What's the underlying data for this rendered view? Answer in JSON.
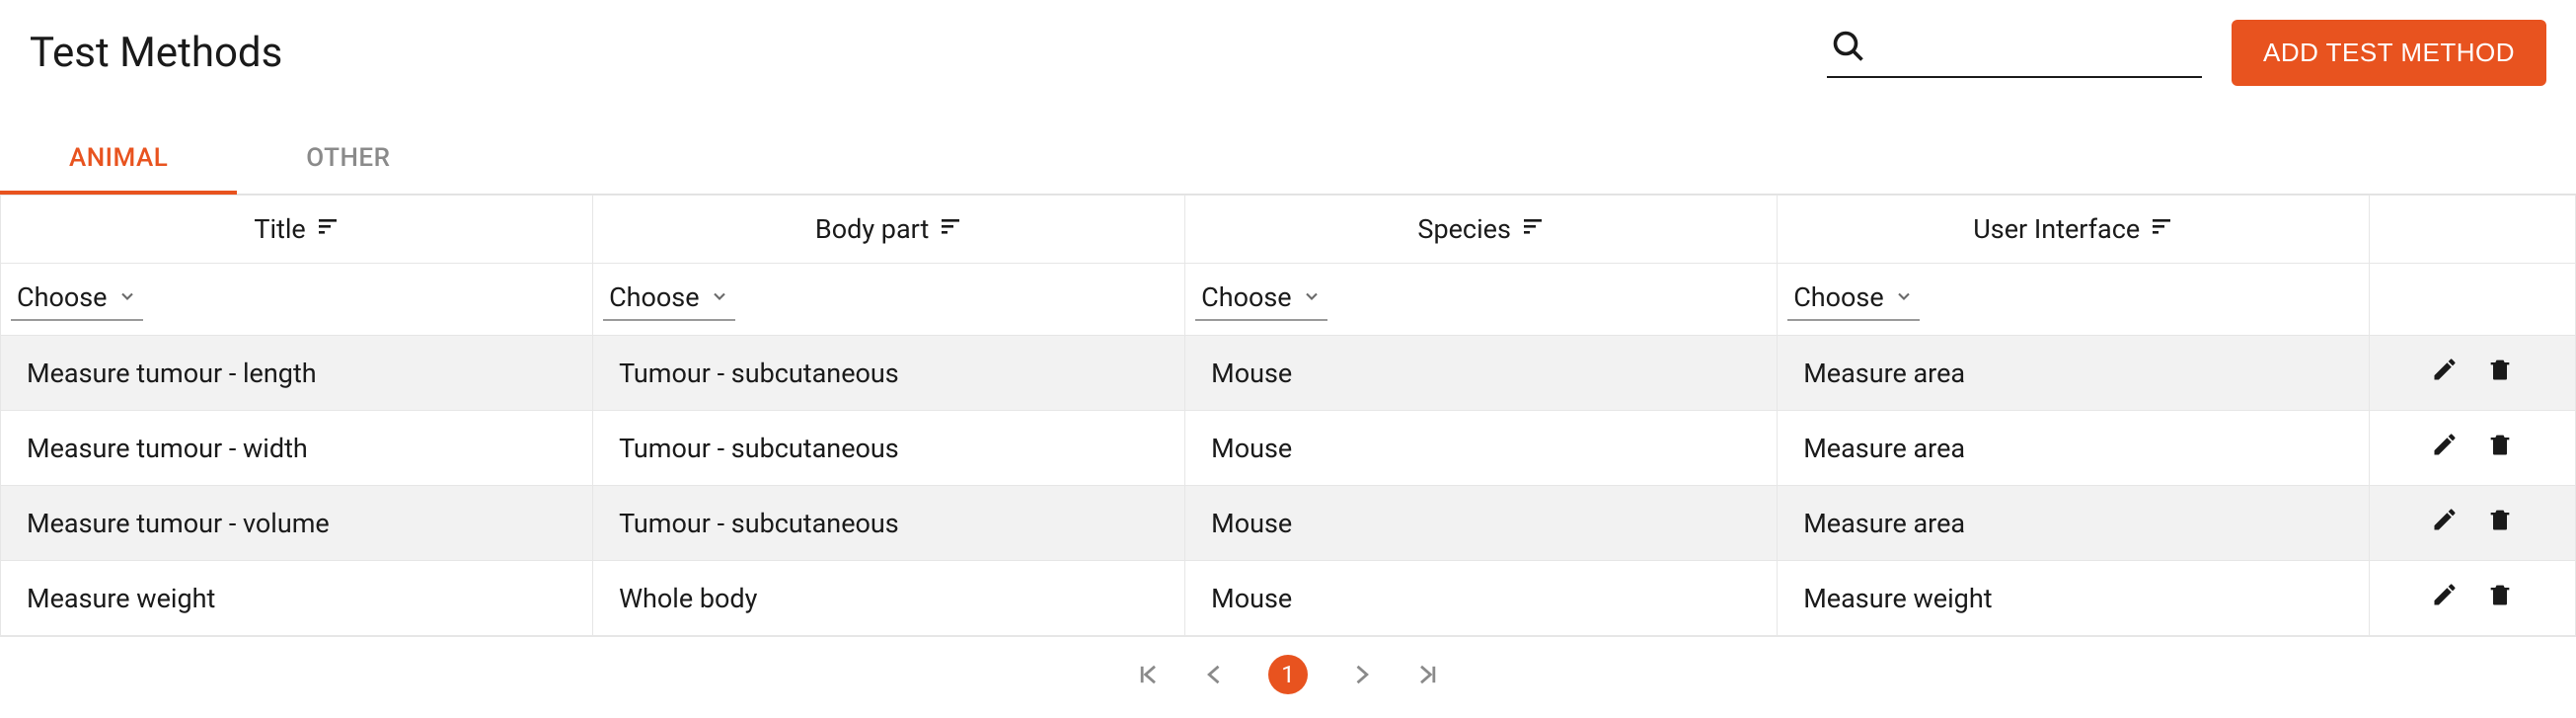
{
  "header": {
    "title": "Test Methods",
    "search_placeholder": "",
    "add_button": "ADD TEST METHOD"
  },
  "tabs": [
    {
      "label": "ANIMAL",
      "active": true
    },
    {
      "label": "OTHER",
      "active": false
    }
  ],
  "columns": {
    "title": "Title",
    "body_part": "Body part",
    "species": "Species",
    "ui": "User Interface"
  },
  "filter_label": "Choose",
  "rows": [
    {
      "title": "Measure tumour - length",
      "body_part": "Tumour - subcutaneous",
      "species": "Mouse",
      "ui": "Measure area"
    },
    {
      "title": "Measure tumour - width",
      "body_part": "Tumour - subcutaneous",
      "species": "Mouse",
      "ui": "Measure area"
    },
    {
      "title": "Measure tumour - volume",
      "body_part": "Tumour - subcutaneous",
      "species": "Mouse",
      "ui": "Measure area"
    },
    {
      "title": "Measure weight",
      "body_part": "Whole body",
      "species": "Mouse",
      "ui": "Measure weight"
    }
  ],
  "pagination": {
    "current": "1"
  },
  "colors": {
    "accent": "#e8531f"
  }
}
